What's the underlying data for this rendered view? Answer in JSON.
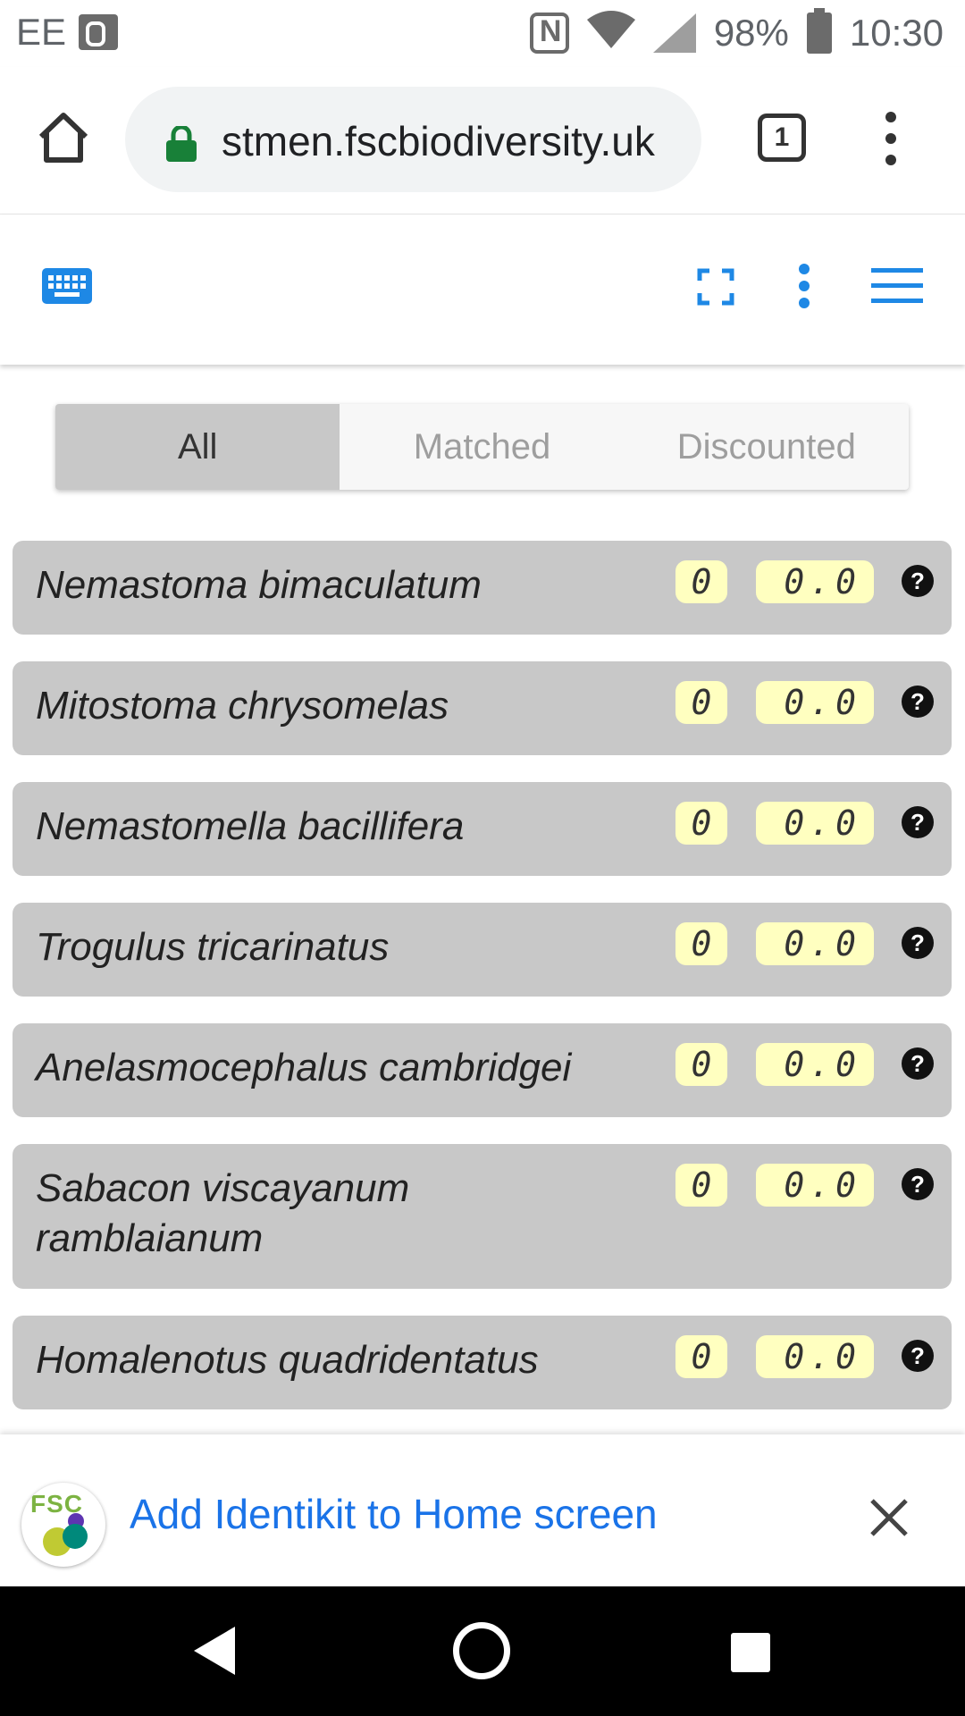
{
  "status_bar": {
    "carrier": "EE",
    "battery": "98%",
    "time": "10:30"
  },
  "browser": {
    "url": "stmen.fscbiodiversity.uk",
    "tab_count": "1"
  },
  "tabs": [
    {
      "label": "All",
      "active": true
    },
    {
      "label": "Matched",
      "active": false
    },
    {
      "label": "Discounted",
      "active": false
    }
  ],
  "species": [
    {
      "name": "Nemastoma bimaculatum",
      "count": "0",
      "score": "0.0"
    },
    {
      "name": "Mitostoma chrysomelas",
      "count": "0",
      "score": "0.0"
    },
    {
      "name": "Nemastomella bacillifera",
      "count": "0",
      "score": "0.0"
    },
    {
      "name": "Trogulus tricarinatus",
      "count": "0",
      "score": "0.0"
    },
    {
      "name": "Anelasmocephalus cambridgei",
      "count": "0",
      "score": "0.0"
    },
    {
      "name": "Sabacon viscayanum ramblaianum",
      "count": "0",
      "score": "0.0"
    },
    {
      "name": "Homalenotus quadridentatus",
      "count": "0",
      "score": "0.0"
    }
  ],
  "banner": {
    "logo_text": "FSC",
    "text": "Add Identikit to Home screen"
  },
  "colors": {
    "accent": "#1e88e5",
    "row_bg": "#c8c8c8",
    "badge_bg": "#ffffc0",
    "link": "#1a73e8"
  }
}
